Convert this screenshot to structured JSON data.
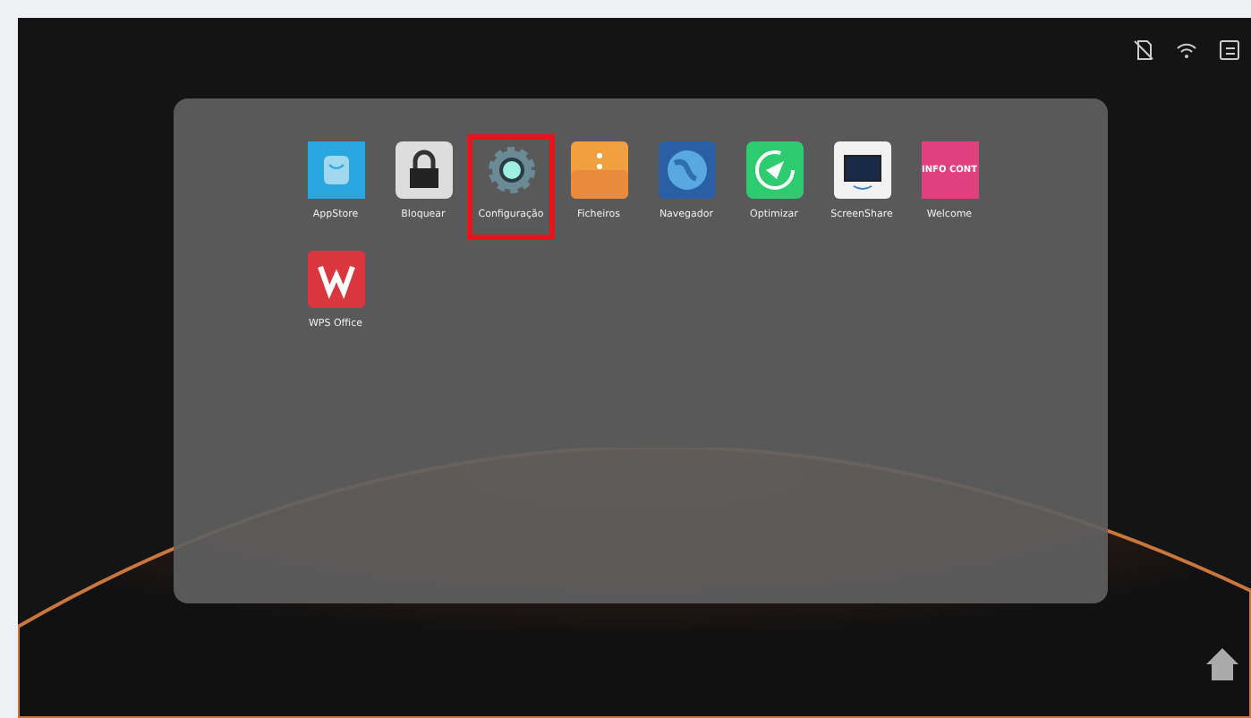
{
  "apps": [
    {
      "label": "AppStore",
      "kind": "store",
      "selected": false
    },
    {
      "label": "Bloquear",
      "kind": "lock",
      "selected": false
    },
    {
      "label": "Configuração",
      "kind": "gear",
      "selected": true
    },
    {
      "label": "Ficheiros",
      "kind": "folder",
      "selected": false
    },
    {
      "label": "Navegador",
      "kind": "globe",
      "selected": false
    },
    {
      "label": "Optimizar",
      "kind": "optimize",
      "selected": false
    },
    {
      "label": "ScreenShare",
      "kind": "screen",
      "selected": false
    },
    {
      "label": "Welcome",
      "kind": "welcome",
      "selected": false,
      "icon_text": "INFO CONT"
    },
    {
      "label": "WPS Office",
      "kind": "wps",
      "selected": false
    }
  ]
}
